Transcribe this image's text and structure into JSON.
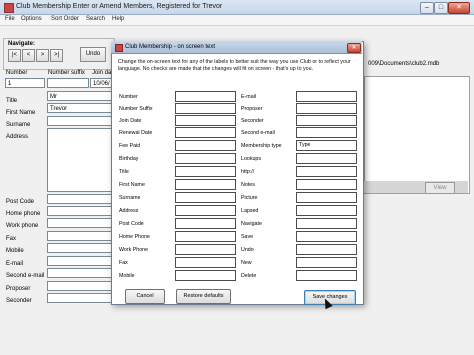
{
  "main_window": {
    "title": "Club Membership Enter or Amend Members, Registered for Trevor",
    "menu": [
      "File",
      "Options",
      "Sort Order",
      "Search",
      "Help"
    ],
    "navigate_label": "Navigate:",
    "nav_buttons": [
      "|<",
      "<",
      ">",
      ">|"
    ],
    "undo_label": "Undo",
    "col_labels": [
      "Number",
      "Number suffix",
      "Join da"
    ],
    "number_value": "1",
    "join_date_value": "10/06/",
    "title_value": "Mr",
    "first_name_value": "Trevor",
    "path_text": "009\\Documents\\club2.mdb",
    "view_button": "View",
    "field_labels": [
      "Title",
      "First Name",
      "Surname",
      "Address",
      "Post Code",
      "Home phone",
      "Work phone",
      "Fax",
      "Mobile",
      "E-mail",
      "Second e-mail",
      "Proposer",
      "Seconder"
    ]
  },
  "dialog": {
    "title": "Club Membership - on screen text",
    "instructions": "Change the on-screen text for any of the labels to better suit the way you use Club or to reflect your language. No checks are made that the changes will fit on screen - that's up to you.",
    "left_labels": [
      "Number",
      "Number Suffix",
      "Join Date",
      "Renewal Date",
      "Fee Paid",
      "Birthday",
      "Title",
      "First Name",
      "Surname",
      "Address",
      "Post Code",
      "Home Phone",
      "Work Phone",
      "Fax",
      "Mobile"
    ],
    "right_labels": [
      "E-mail",
      "Proposer",
      "Seconder",
      "Second e-mail",
      "Membership type",
      "Lookups",
      "http://",
      "Notes",
      "Picture",
      "Lapsed",
      "Navigate",
      "Save",
      "Undo",
      "New",
      "Delete"
    ],
    "right_field_values": {
      "membership_type": "Type"
    },
    "buttons": {
      "cancel": "Cancel",
      "restore": "Restore defaults",
      "save": "Save changes"
    }
  }
}
